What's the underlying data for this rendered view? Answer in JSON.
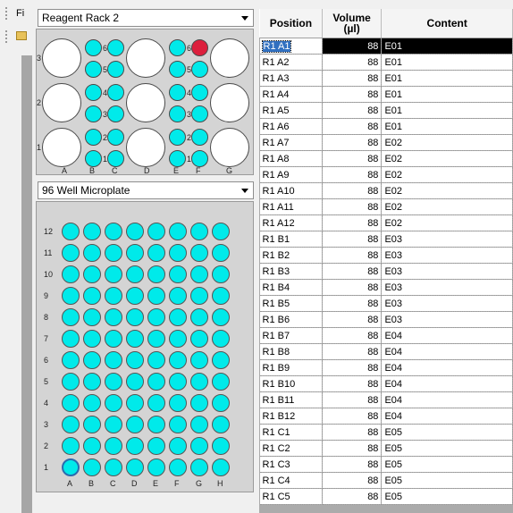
{
  "window": {
    "title_fragment": "Fi"
  },
  "rack": {
    "selector_value": "Reagent Rack 2",
    "row_labels": [
      "3",
      "2",
      "1"
    ],
    "col_labels": [
      "A",
      "B",
      "C",
      "D",
      "E",
      "F",
      "G"
    ],
    "tube_labels": [
      "6",
      "5",
      "4",
      "3",
      "2",
      "1"
    ],
    "highlight_tube": "F6"
  },
  "plate": {
    "selector_value": "96 Well Microplate",
    "row_labels": [
      "12",
      "11",
      "10",
      "9",
      "8",
      "7",
      "6",
      "5",
      "4",
      "3",
      "2",
      "1"
    ],
    "col_labels": [
      "A",
      "B",
      "C",
      "D",
      "E",
      "F",
      "G",
      "H"
    ],
    "selected_well": "A1"
  },
  "grid": {
    "headers": {
      "position": "Position",
      "volume": "Volume (µl)",
      "content": "Content"
    },
    "rows": [
      {
        "position": "R1 A1",
        "volume": "88",
        "content": "E01"
      },
      {
        "position": "R1 A2",
        "volume": "88",
        "content": "E01"
      },
      {
        "position": "R1 A3",
        "volume": "88",
        "content": "E01"
      },
      {
        "position": "R1 A4",
        "volume": "88",
        "content": "E01"
      },
      {
        "position": "R1 A5",
        "volume": "88",
        "content": "E01"
      },
      {
        "position": "R1 A6",
        "volume": "88",
        "content": "E01"
      },
      {
        "position": "R1 A7",
        "volume": "88",
        "content": "E02"
      },
      {
        "position": "R1 A8",
        "volume": "88",
        "content": "E02"
      },
      {
        "position": "R1 A9",
        "volume": "88",
        "content": "E02"
      },
      {
        "position": "R1 A10",
        "volume": "88",
        "content": "E02"
      },
      {
        "position": "R1 A11",
        "volume": "88",
        "content": "E02"
      },
      {
        "position": "R1 A12",
        "volume": "88",
        "content": "E02"
      },
      {
        "position": "R1 B1",
        "volume": "88",
        "content": "E03"
      },
      {
        "position": "R1 B2",
        "volume": "88",
        "content": "E03"
      },
      {
        "position": "R1 B3",
        "volume": "88",
        "content": "E03"
      },
      {
        "position": "R1 B4",
        "volume": "88",
        "content": "E03"
      },
      {
        "position": "R1 B5",
        "volume": "88",
        "content": "E03"
      },
      {
        "position": "R1 B6",
        "volume": "88",
        "content": "E03"
      },
      {
        "position": "R1 B7",
        "volume": "88",
        "content": "E04"
      },
      {
        "position": "R1 B8",
        "volume": "88",
        "content": "E04"
      },
      {
        "position": "R1 B9",
        "volume": "88",
        "content": "E04"
      },
      {
        "position": "R1 B10",
        "volume": "88",
        "content": "E04"
      },
      {
        "position": "R1 B11",
        "volume": "88",
        "content": "E04"
      },
      {
        "position": "R1 B12",
        "volume": "88",
        "content": "E04"
      },
      {
        "position": "R1 C1",
        "volume": "88",
        "content": "E05"
      },
      {
        "position": "R1 C2",
        "volume": "88",
        "content": "E05"
      },
      {
        "position": "R1 C3",
        "volume": "88",
        "content": "E05"
      },
      {
        "position": "R1 C4",
        "volume": "88",
        "content": "E05"
      },
      {
        "position": "R1 C5",
        "volume": "88",
        "content": "E05"
      }
    ],
    "selected_index": 0
  },
  "colors": {
    "well_fill": "#00eaea",
    "highlight_tube": "#dc1f3c",
    "selection": "#000000"
  }
}
